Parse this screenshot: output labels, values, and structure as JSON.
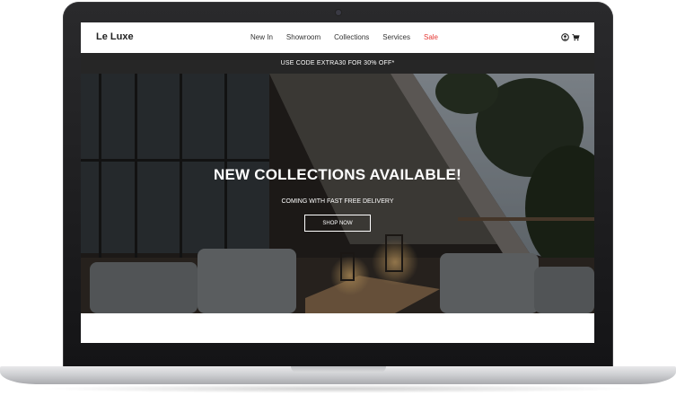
{
  "site": {
    "logo": "Le Luxe",
    "nav": {
      "items": [
        {
          "label": "New In"
        },
        {
          "label": "Showroom"
        },
        {
          "label": "Collections"
        },
        {
          "label": "Services"
        },
        {
          "label": "Sale"
        }
      ],
      "icons": [
        "user-icon",
        "cart-icon"
      ]
    },
    "promo": "USE CODE EXTRA30 FOR 30% OFF*",
    "hero": {
      "title": "NEW COLLECTIONS AVAILABLE!",
      "subtitle": "COMING WITH FAST FREE DELIVERY",
      "button_label": "SHOP NOW"
    }
  },
  "colors": {
    "sale": "#e53935",
    "promo_bar": "#262626",
    "laptop_bezel": "#1c1c1e"
  }
}
